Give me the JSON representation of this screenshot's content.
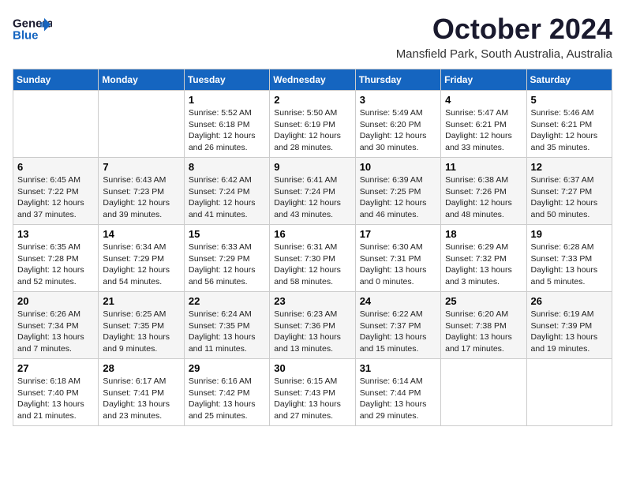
{
  "header": {
    "logo_line1": "General",
    "logo_line2": "Blue",
    "month": "October 2024",
    "location": "Mansfield Park, South Australia, Australia"
  },
  "days_of_week": [
    "Sunday",
    "Monday",
    "Tuesday",
    "Wednesday",
    "Thursday",
    "Friday",
    "Saturday"
  ],
  "weeks": [
    [
      {
        "day": "",
        "info": ""
      },
      {
        "day": "",
        "info": ""
      },
      {
        "day": "1",
        "info": "Sunrise: 5:52 AM\nSunset: 6:18 PM\nDaylight: 12 hours\nand 26 minutes."
      },
      {
        "day": "2",
        "info": "Sunrise: 5:50 AM\nSunset: 6:19 PM\nDaylight: 12 hours\nand 28 minutes."
      },
      {
        "day": "3",
        "info": "Sunrise: 5:49 AM\nSunset: 6:20 PM\nDaylight: 12 hours\nand 30 minutes."
      },
      {
        "day": "4",
        "info": "Sunrise: 5:47 AM\nSunset: 6:21 PM\nDaylight: 12 hours\nand 33 minutes."
      },
      {
        "day": "5",
        "info": "Sunrise: 5:46 AM\nSunset: 6:21 PM\nDaylight: 12 hours\nand 35 minutes."
      }
    ],
    [
      {
        "day": "6",
        "info": "Sunrise: 6:45 AM\nSunset: 7:22 PM\nDaylight: 12 hours\nand 37 minutes."
      },
      {
        "day": "7",
        "info": "Sunrise: 6:43 AM\nSunset: 7:23 PM\nDaylight: 12 hours\nand 39 minutes."
      },
      {
        "day": "8",
        "info": "Sunrise: 6:42 AM\nSunset: 7:24 PM\nDaylight: 12 hours\nand 41 minutes."
      },
      {
        "day": "9",
        "info": "Sunrise: 6:41 AM\nSunset: 7:24 PM\nDaylight: 12 hours\nand 43 minutes."
      },
      {
        "day": "10",
        "info": "Sunrise: 6:39 AM\nSunset: 7:25 PM\nDaylight: 12 hours\nand 46 minutes."
      },
      {
        "day": "11",
        "info": "Sunrise: 6:38 AM\nSunset: 7:26 PM\nDaylight: 12 hours\nand 48 minutes."
      },
      {
        "day": "12",
        "info": "Sunrise: 6:37 AM\nSunset: 7:27 PM\nDaylight: 12 hours\nand 50 minutes."
      }
    ],
    [
      {
        "day": "13",
        "info": "Sunrise: 6:35 AM\nSunset: 7:28 PM\nDaylight: 12 hours\nand 52 minutes."
      },
      {
        "day": "14",
        "info": "Sunrise: 6:34 AM\nSunset: 7:29 PM\nDaylight: 12 hours\nand 54 minutes."
      },
      {
        "day": "15",
        "info": "Sunrise: 6:33 AM\nSunset: 7:29 PM\nDaylight: 12 hours\nand 56 minutes."
      },
      {
        "day": "16",
        "info": "Sunrise: 6:31 AM\nSunset: 7:30 PM\nDaylight: 12 hours\nand 58 minutes."
      },
      {
        "day": "17",
        "info": "Sunrise: 6:30 AM\nSunset: 7:31 PM\nDaylight: 13 hours\nand 0 minutes."
      },
      {
        "day": "18",
        "info": "Sunrise: 6:29 AM\nSunset: 7:32 PM\nDaylight: 13 hours\nand 3 minutes."
      },
      {
        "day": "19",
        "info": "Sunrise: 6:28 AM\nSunset: 7:33 PM\nDaylight: 13 hours\nand 5 minutes."
      }
    ],
    [
      {
        "day": "20",
        "info": "Sunrise: 6:26 AM\nSunset: 7:34 PM\nDaylight: 13 hours\nand 7 minutes."
      },
      {
        "day": "21",
        "info": "Sunrise: 6:25 AM\nSunset: 7:35 PM\nDaylight: 13 hours\nand 9 minutes."
      },
      {
        "day": "22",
        "info": "Sunrise: 6:24 AM\nSunset: 7:35 PM\nDaylight: 13 hours\nand 11 minutes."
      },
      {
        "day": "23",
        "info": "Sunrise: 6:23 AM\nSunset: 7:36 PM\nDaylight: 13 hours\nand 13 minutes."
      },
      {
        "day": "24",
        "info": "Sunrise: 6:22 AM\nSunset: 7:37 PM\nDaylight: 13 hours\nand 15 minutes."
      },
      {
        "day": "25",
        "info": "Sunrise: 6:20 AM\nSunset: 7:38 PM\nDaylight: 13 hours\nand 17 minutes."
      },
      {
        "day": "26",
        "info": "Sunrise: 6:19 AM\nSunset: 7:39 PM\nDaylight: 13 hours\nand 19 minutes."
      }
    ],
    [
      {
        "day": "27",
        "info": "Sunrise: 6:18 AM\nSunset: 7:40 PM\nDaylight: 13 hours\nand 21 minutes."
      },
      {
        "day": "28",
        "info": "Sunrise: 6:17 AM\nSunset: 7:41 PM\nDaylight: 13 hours\nand 23 minutes."
      },
      {
        "day": "29",
        "info": "Sunrise: 6:16 AM\nSunset: 7:42 PM\nDaylight: 13 hours\nand 25 minutes."
      },
      {
        "day": "30",
        "info": "Sunrise: 6:15 AM\nSunset: 7:43 PM\nDaylight: 13 hours\nand 27 minutes."
      },
      {
        "day": "31",
        "info": "Sunrise: 6:14 AM\nSunset: 7:44 PM\nDaylight: 13 hours\nand 29 minutes."
      },
      {
        "day": "",
        "info": ""
      },
      {
        "day": "",
        "info": ""
      }
    ]
  ]
}
